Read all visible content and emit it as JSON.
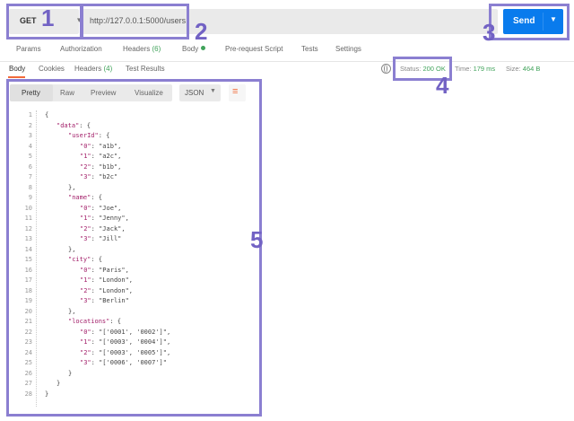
{
  "request": {
    "method": "GET",
    "url": "http://127.0.0.1:5000/users",
    "send_label": "Send"
  },
  "request_tabs": [
    {
      "label": "Params"
    },
    {
      "label": "Authorization"
    },
    {
      "label": "Headers",
      "count": "(6)"
    },
    {
      "label": "Body"
    },
    {
      "label": "Pre-request Script"
    },
    {
      "label": "Tests"
    },
    {
      "label": "Settings"
    }
  ],
  "response_tabs": [
    {
      "label": "Body"
    },
    {
      "label": "Cookies"
    },
    {
      "label": "Headers",
      "count": "(4)"
    },
    {
      "label": "Test Results"
    }
  ],
  "status": {
    "status_label": "Status:",
    "status_value": "200 OK",
    "time_label": "Time:",
    "time_value": "179 ms",
    "size_label": "Size:",
    "size_value": "464 B"
  },
  "body_toolbar": {
    "views": [
      "Pretty",
      "Raw",
      "Preview",
      "Visualize"
    ],
    "format": "JSON"
  },
  "code_lines": [
    {
      "n": "1",
      "indent": 0,
      "key": "",
      "val": "{"
    },
    {
      "n": "2",
      "indent": 1,
      "key": "\"data\"",
      "val": ": {"
    },
    {
      "n": "3",
      "indent": 2,
      "key": "\"userId\"",
      "val": ": {"
    },
    {
      "n": "4",
      "indent": 3,
      "key": "\"0\"",
      "val": ": \"a1b\","
    },
    {
      "n": "5",
      "indent": 3,
      "key": "\"1\"",
      "val": ": \"a2c\","
    },
    {
      "n": "6",
      "indent": 3,
      "key": "\"2\"",
      "val": ": \"b1b\","
    },
    {
      "n": "7",
      "indent": 3,
      "key": "\"3\"",
      "val": ": \"b2c\""
    },
    {
      "n": "8",
      "indent": 2,
      "key": "",
      "val": "},"
    },
    {
      "n": "9",
      "indent": 2,
      "key": "\"name\"",
      "val": ": {"
    },
    {
      "n": "10",
      "indent": 3,
      "key": "\"0\"",
      "val": ": \"Joe\","
    },
    {
      "n": "11",
      "indent": 3,
      "key": "\"1\"",
      "val": ": \"Jenny\","
    },
    {
      "n": "12",
      "indent": 3,
      "key": "\"2\"",
      "val": ": \"Jack\","
    },
    {
      "n": "13",
      "indent": 3,
      "key": "\"3\"",
      "val": ": \"Jill\""
    },
    {
      "n": "14",
      "indent": 2,
      "key": "",
      "val": "},"
    },
    {
      "n": "15",
      "indent": 2,
      "key": "\"city\"",
      "val": ": {"
    },
    {
      "n": "16",
      "indent": 3,
      "key": "\"0\"",
      "val": ": \"Paris\","
    },
    {
      "n": "17",
      "indent": 3,
      "key": "\"1\"",
      "val": ": \"London\","
    },
    {
      "n": "18",
      "indent": 3,
      "key": "\"2\"",
      "val": ": \"London\","
    },
    {
      "n": "19",
      "indent": 3,
      "key": "\"3\"",
      "val": ": \"Berlin\""
    },
    {
      "n": "20",
      "indent": 2,
      "key": "",
      "val": "},"
    },
    {
      "n": "21",
      "indent": 2,
      "key": "\"locations\"",
      "val": ": {"
    },
    {
      "n": "22",
      "indent": 3,
      "key": "\"0\"",
      "val": ": \"['0001', '0002']\","
    },
    {
      "n": "23",
      "indent": 3,
      "key": "\"1\"",
      "val": ": \"['0003', '0004']\","
    },
    {
      "n": "24",
      "indent": 3,
      "key": "\"2\"",
      "val": ": \"['0003', '0005']\","
    },
    {
      "n": "25",
      "indent": 3,
      "key": "\"3\"",
      "val": ": \"['0006', '0007']\""
    },
    {
      "n": "26",
      "indent": 2,
      "key": "",
      "val": "}"
    },
    {
      "n": "27",
      "indent": 1,
      "key": "",
      "val": "}"
    },
    {
      "n": "28",
      "indent": 0,
      "key": "",
      "val": "}"
    }
  ],
  "annotations": [
    "1",
    "2",
    "3",
    "4",
    "5"
  ],
  "colors": {
    "send_button": "#097bed",
    "annotation": "#7262c4",
    "status_ok": "#41a35b",
    "accent": "#f26b3a"
  },
  "icons": {
    "method_dropdown": "chevron-down-icon",
    "send_dropdown": "chevron-down-icon",
    "body_dot": "status-dot-icon",
    "globe": "globe-icon",
    "wrap": "wrap-lines-icon"
  }
}
